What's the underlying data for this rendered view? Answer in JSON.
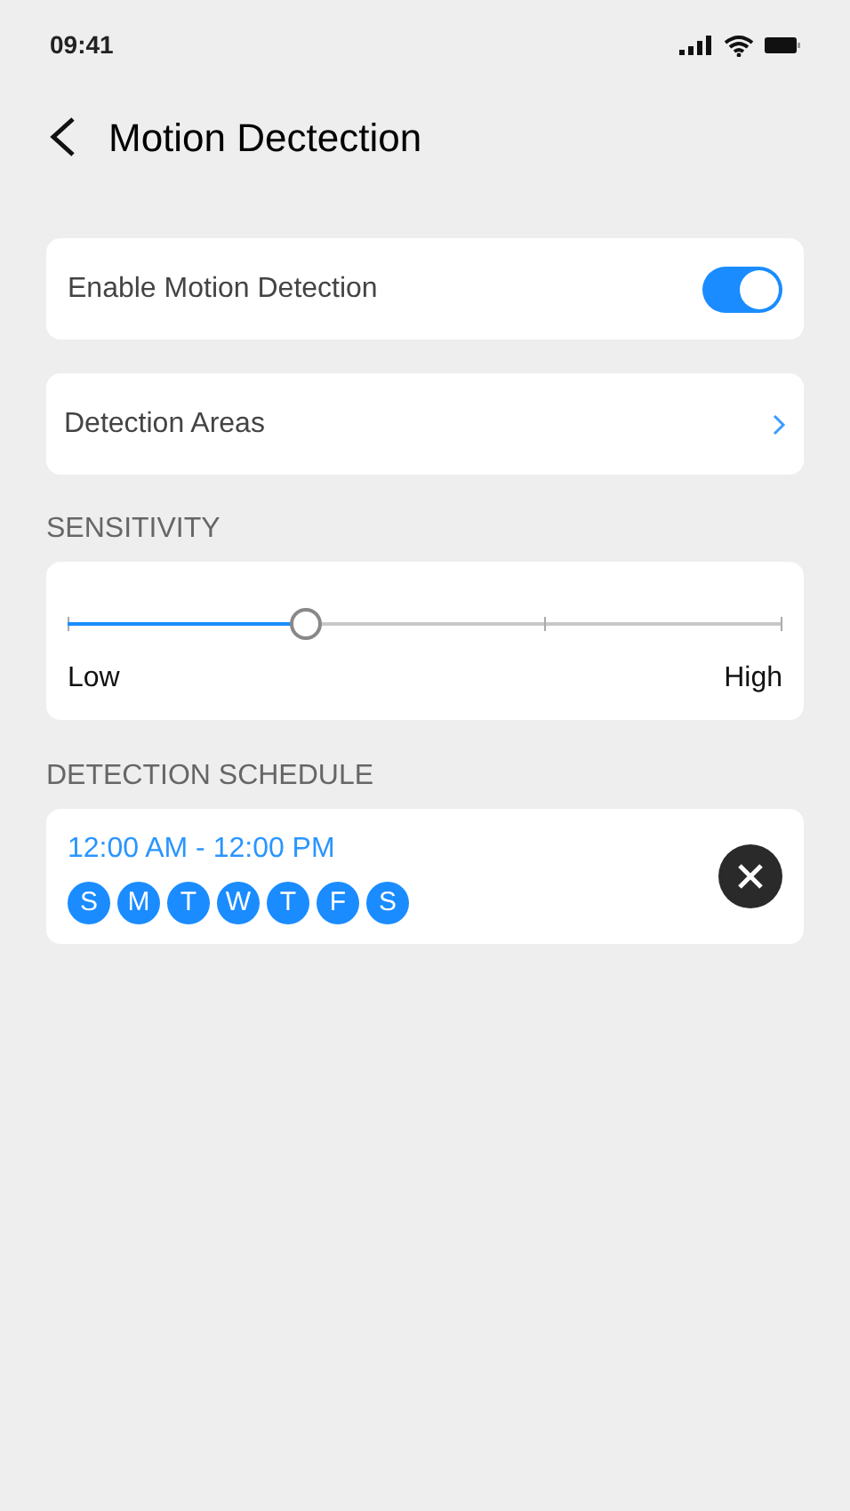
{
  "status_bar": {
    "time": "09:41"
  },
  "header": {
    "title": "Motion Dectection"
  },
  "motion_toggle": {
    "label": "Enable Motion Detection",
    "on": true
  },
  "detection_areas": {
    "label": "Detection Areas"
  },
  "sensitivity": {
    "heading": "SENSITIVITY",
    "level": 0.334,
    "low_label": "Low",
    "high_label": "High"
  },
  "schedule": {
    "heading": "DETECTION SCHEDULE",
    "time_range": "12:00 AM - 12:00 PM",
    "days": [
      {
        "label": "S",
        "selected": true
      },
      {
        "label": "M",
        "selected": true
      },
      {
        "label": "T",
        "selected": true
      },
      {
        "label": "W",
        "selected": true
      },
      {
        "label": "T",
        "selected": true
      },
      {
        "label": "F",
        "selected": true
      },
      {
        "label": "S",
        "selected": true
      }
    ]
  }
}
